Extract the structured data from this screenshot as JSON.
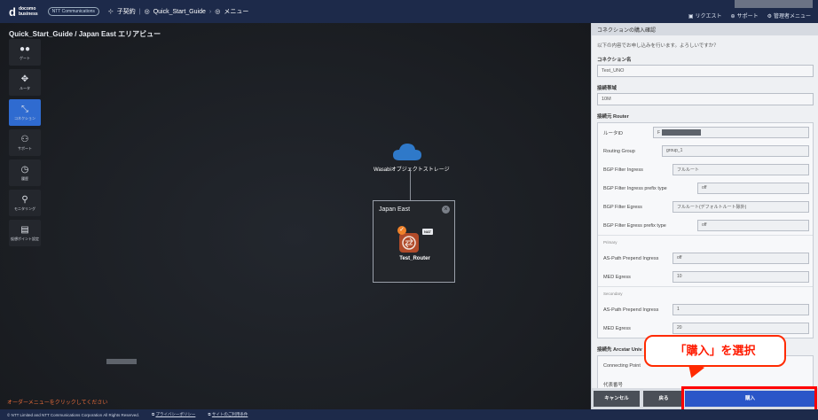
{
  "header": {
    "logo_mark": "d",
    "logo_brand_1": "docomo",
    "logo_brand_2": "business",
    "logo_ntt": "NTT Communications",
    "contract_label": "子契約",
    "breadcrumb_1": "Quick_Start_Guide",
    "breadcrumb_2": "メニュー",
    "request_label": "リクエスト",
    "support_label": "サポート",
    "admin_label": "管理者メニュー"
  },
  "canvas": {
    "title": "Quick_Start_Guide / Japan East エリアビュー",
    "cloud_label": "Wasabiオブジェクトストレージ",
    "area_title": "Japan East",
    "router_label": "Test_Router",
    "nat_badge": "NAT",
    "order_hint": "オーダーメニューをクリックしてください"
  },
  "sidebar": {
    "items": [
      {
        "label": "ゲート",
        "icon": "gate-icon"
      },
      {
        "label": "ルータ",
        "icon": "router-icon"
      },
      {
        "label": "コネクション",
        "icon": "connection-icon"
      },
      {
        "label": "サポート",
        "icon": "support-icon"
      },
      {
        "label": "履歴",
        "icon": "history-icon"
      },
      {
        "label": "モニタリング",
        "icon": "monitoring-icon"
      },
      {
        "label": "仮想ポイント設定",
        "icon": "virtual-point-icon"
      }
    ]
  },
  "panel": {
    "title": "コネクションの購入確認",
    "confirm_text": "以下の内容でお申し込みを行います。よろしいですか？",
    "conn_name_label": "コネクション名",
    "conn_name_value": "Test_UNO",
    "bandwidth_label": "接続帯域",
    "bandwidth_value": "10M",
    "router_section_label": "接続元 Router",
    "router_id_label": "ルータID",
    "router_id_prefix": "F",
    "routing_group_label": "Routing Group",
    "routing_group_value": "group_1",
    "bgp_ingress_label": "BGP Filter Ingress",
    "bgp_ingress_value": "フルルート",
    "bgp_ingress_prefix_label": "BGP Filter Ingress prefix type",
    "bgp_ingress_prefix_value": "off",
    "bgp_egress_label": "BGP Filter Egress",
    "bgp_egress_value": "フルルート(デフォルトルート除外)",
    "bgp_egress_prefix_label": "BGP Filter Egress prefix type",
    "bgp_egress_prefix_value": "off",
    "primary_label": "Primary",
    "as_path_label": "AS-Path Prepend Ingress",
    "primary_as_path_value": "off",
    "med_label": "MED Egress",
    "primary_med_value": "10",
    "secondary_label": "Secondary",
    "secondary_as_path_value": "1",
    "secondary_med_value": "20",
    "arcstar_label": "接続先 Arcstar Univ",
    "connecting_point_label": "Connecting Point",
    "rep_number_label": "代表番号",
    "cancel_label": "キャンセル",
    "back_label": "戻る",
    "buy_label": "購入"
  },
  "callout": {
    "text": "「購入」を選択"
  },
  "footer": {
    "copyright": "© NTT Limited and NTT Communications Corporation All Rights Reserved.",
    "privacy": "プライバシーポリシー",
    "terms": "サイトのご利用条件"
  }
}
